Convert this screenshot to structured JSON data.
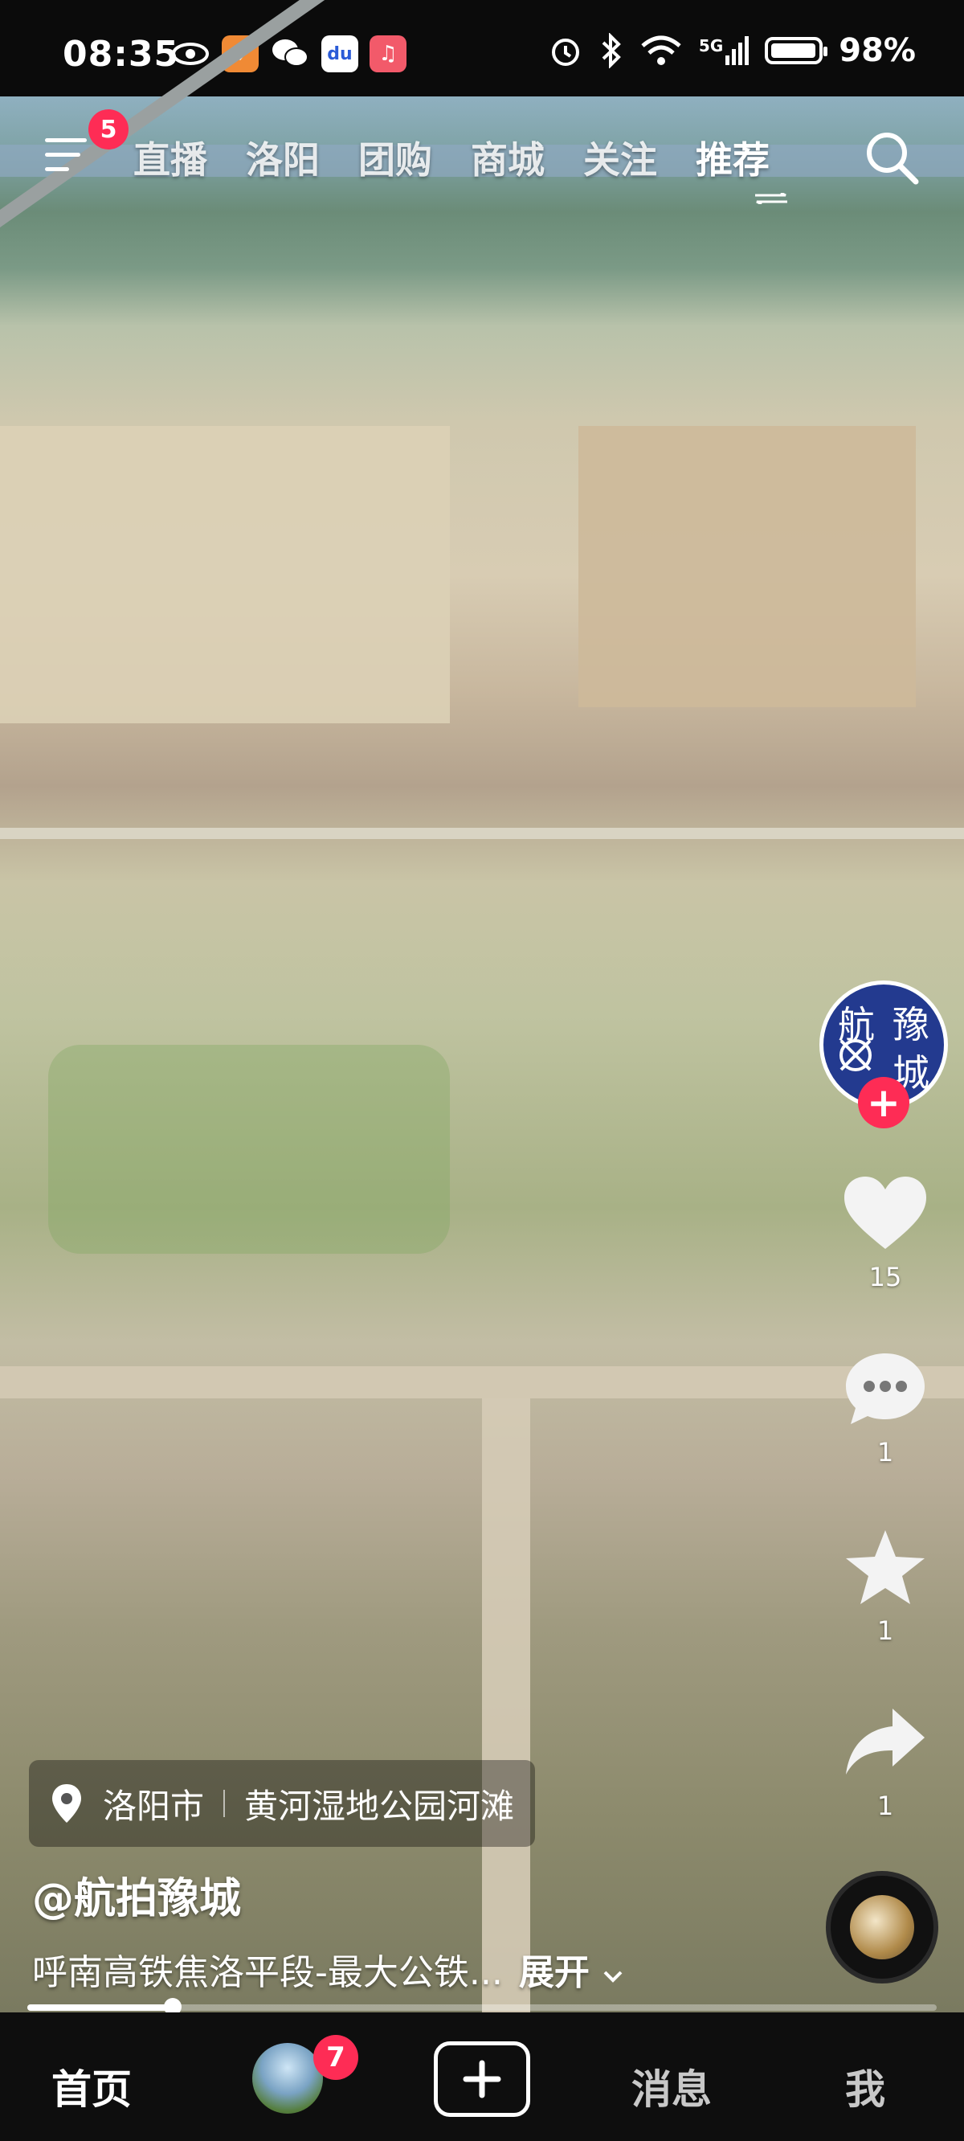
{
  "status_bar": {
    "time": "08:35",
    "network": "5G",
    "battery_text": "98%",
    "battery_level": 0.98
  },
  "top_nav": {
    "menu_badge": "5",
    "tabs": [
      "直播",
      "洛阳",
      "团购",
      "商城",
      "关注",
      "推荐"
    ],
    "active_tab": "推荐"
  },
  "creator": {
    "avatar_chars": [
      "航",
      "豫",
      "城"
    ]
  },
  "actions": {
    "likes": "15",
    "comments": "1",
    "favorites": "1",
    "shares": "1"
  },
  "location": {
    "city": "洛阳市",
    "place": "黄河湿地公园河滩"
  },
  "post": {
    "author": "@航拍豫城",
    "description": "呼南高铁焦洛平段-最大公铁...",
    "expand_label": "展开"
  },
  "progress": {
    "fraction": 0.16
  },
  "bottom_nav": {
    "home": "首页",
    "friends_badge": "7",
    "messages": "消息",
    "me": "我"
  },
  "colors": {
    "accent_red": "#fe2c55",
    "avatar_blue": "#233a8f"
  }
}
